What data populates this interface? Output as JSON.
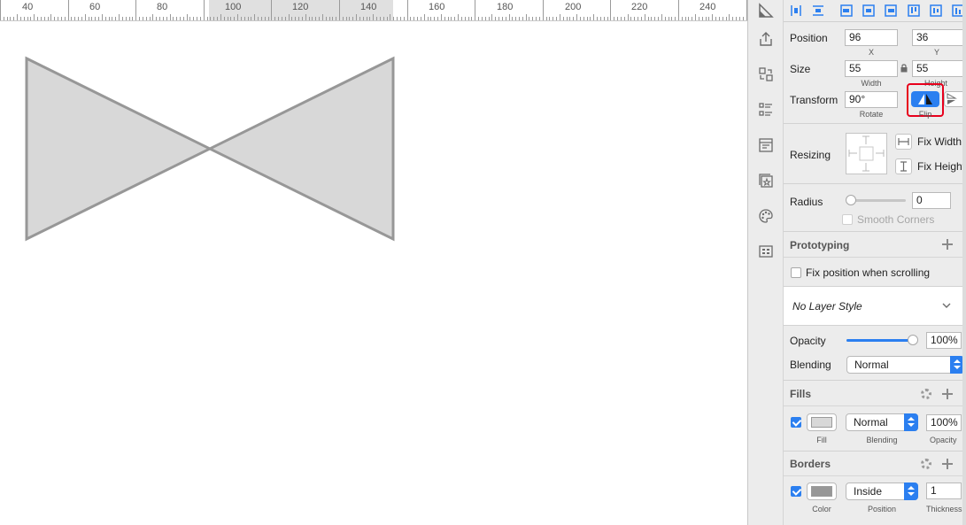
{
  "ruler": {
    "labels": [
      "40",
      "60",
      "80",
      "100",
      "120",
      "140",
      "160",
      "180",
      "200",
      "220",
      "240"
    ]
  },
  "sidebar_icons": [
    "inspector-icon",
    "export-icon",
    "swap-icon",
    "layer-list-icon",
    "layout-icon",
    "symbol-icon",
    "palette-icon",
    "grid-icon"
  ],
  "inspector": {
    "position": {
      "label": "Position",
      "x": "96",
      "y": "36",
      "x_sub": "X",
      "y_sub": "Y"
    },
    "size": {
      "label": "Size",
      "width": "55",
      "height": "55",
      "width_sub": "Width",
      "height_sub": "Height"
    },
    "transform": {
      "label": "Transform",
      "rotate": "90°",
      "rotate_sub": "Rotate",
      "flip_sub": "Flip"
    },
    "resizing": {
      "label": "Resizing",
      "fix_width": "Fix Width",
      "fix_height": "Fix Height"
    },
    "radius": {
      "label": "Radius",
      "value": "0",
      "smooth_corners": "Smooth Corners"
    },
    "prototyping": {
      "title": "Prototyping",
      "fix_position": "Fix position when scrolling"
    },
    "layer_style": {
      "value": "No Layer Style"
    },
    "opacity": {
      "label": "Opacity",
      "value": "100%",
      "level": 1.0
    },
    "blending": {
      "label": "Blending",
      "value": "Normal"
    },
    "fills": {
      "title": "Fills",
      "blending": "Normal",
      "opacity": "100%",
      "fill_sub": "Fill",
      "blending_sub": "Blending",
      "opacity_sub": "Opacity",
      "color": "#d8d8d8"
    },
    "borders": {
      "title": "Borders",
      "position": "Inside",
      "thickness": "1",
      "color_sub": "Color",
      "position_sub": "Position",
      "thickness_sub": "Thickness",
      "color": "#979797"
    }
  },
  "colors": {
    "shape_fill": "#d8d8d8",
    "shape_stroke": "#979797",
    "accent": "#2b7ff0",
    "highlight": "#e8001c"
  }
}
